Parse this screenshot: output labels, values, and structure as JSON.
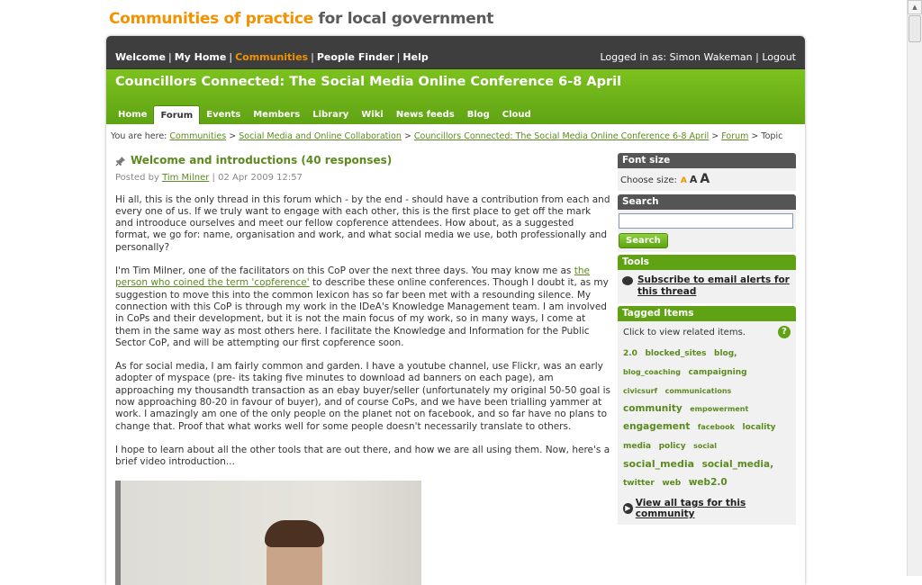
{
  "site": {
    "logo_highlight": "Communities of practice",
    "logo_rest": "for local government"
  },
  "topnav": {
    "items": [
      "Welcome",
      "My Home",
      "Communities",
      "People Finder",
      "Help"
    ],
    "logged_in_text": "Logged in as: Simon Wakeman",
    "logout_label": "Logout"
  },
  "community": {
    "title": "Councillors Connected: The Social Media Online Conference 6-8 April",
    "tabs": [
      "Home",
      "Forum",
      "Events",
      "Members",
      "Library",
      "Wiki",
      "News feeds",
      "Blog",
      "Cloud"
    ]
  },
  "breadcrumb": {
    "prefix": "You are here:",
    "links": [
      "Communities",
      "Social Media and Online Collaboration",
      "Councillors Connected: The Social Media Online Conference 6-8 April",
      "Forum"
    ],
    "current": "Topic",
    "separator": ">"
  },
  "post": {
    "title": "Welcome and introductions (40 responses)",
    "posted_by_label": "Posted by",
    "author": "Tim Milner",
    "date": "| 02 Apr 2009 12:57",
    "p1": "Hi all, this is the only thread in this forum which - by the end - should have a contribution from each and every one of us. If we truly want to engage with each other, this is the first place to get off the mark and introoduce ourselves and meet our fellow copference attendees. How about, as a suggested format, we go for: name, organisation and work, and what social media we use, both professionally and personally?",
    "p2_before": "I'm Tim Milner, one of the facilitators on this CoP over the next three days. You may know me as ",
    "p2_link": "the person who coined the term 'copference'",
    "p2_after": " to describe these online conferences. Though I doubt it, as my suggestion to move this into the common lexicon has so far been met with a resounding silence. My connection with this CoP is through my work in the IDeA's Knowledge Management team. I am involved in CoPs and their development, but it is not the main focus of my work, so in many ways, I come at them in the same way as most others here. I facilitate the Knowledge and Information for the Public Sector CoP, and will be attempting our first copference soon.",
    "p3": "As for social media, I am fairly common and garden. I have a youtube channel, use Flickr, was an early adopter of myspace (pre- its taking five minutes to download ad banners on each page), am approaching my thousandth transaction as an ebay buyer/seller (unfortunately my original 50-50 goal is now approaching 80-20 in favour of buyer), and of course CoPs, and we have been trialling yammer at work. I amazingly am one of the only people on the planet not on facebook, and so far have no plans to change that. Proof that what works well for some people doesn't necessarily translate to others.",
    "p4": "I hope to learn about all the other tools that are out there, and how we are all using them. Now, here's a brief video introduction..."
  },
  "sidebar": {
    "font_size_header": "Font size",
    "choose_size_label": "Choose size:",
    "size_small": "A",
    "size_medium": "A",
    "size_large": "A",
    "search_header": "Search",
    "search_button": "Search",
    "search_value": "",
    "tools_header": "Tools",
    "subscribe_link": "Subscribe to email alerts for this thread",
    "tagged_header": "Tagged Items",
    "tag_hint": "Click to view related items.",
    "help_glyph": "?",
    "tags": [
      {
        "label": "2.0",
        "size": "m"
      },
      {
        "label": "blocked_sites",
        "size": "m"
      },
      {
        "label": "blog,",
        "size": "m"
      },
      {
        "label": "blog_coaching",
        "size": "s"
      },
      {
        "label": "campaigning",
        "size": "m"
      },
      {
        "label": "civicsurf",
        "size": "s"
      },
      {
        "label": "communications",
        "size": "s"
      },
      {
        "label": "community",
        "size": "l"
      },
      {
        "label": "empowerment",
        "size": "s"
      },
      {
        "label": "engagement",
        "size": "l"
      },
      {
        "label": "facebook",
        "size": "s"
      },
      {
        "label": "locality",
        "size": "m"
      },
      {
        "label": "media",
        "size": "m"
      },
      {
        "label": "policy",
        "size": "m"
      },
      {
        "label": "social",
        "size": "s"
      },
      {
        "label": "social_media",
        "size": "xl"
      },
      {
        "label": "social_media,",
        "size": "l"
      },
      {
        "label": "twitter",
        "size": "m"
      },
      {
        "label": "web",
        "size": "m"
      },
      {
        "label": "web2.0",
        "size": "l"
      }
    ],
    "view_all_link": "View all tags for this community"
  },
  "colors": {
    "brand_orange": "#f39200",
    "brand_green": "#5fa314",
    "nav_dark": "#3e3e3e",
    "link_green": "#5b8a1e"
  }
}
